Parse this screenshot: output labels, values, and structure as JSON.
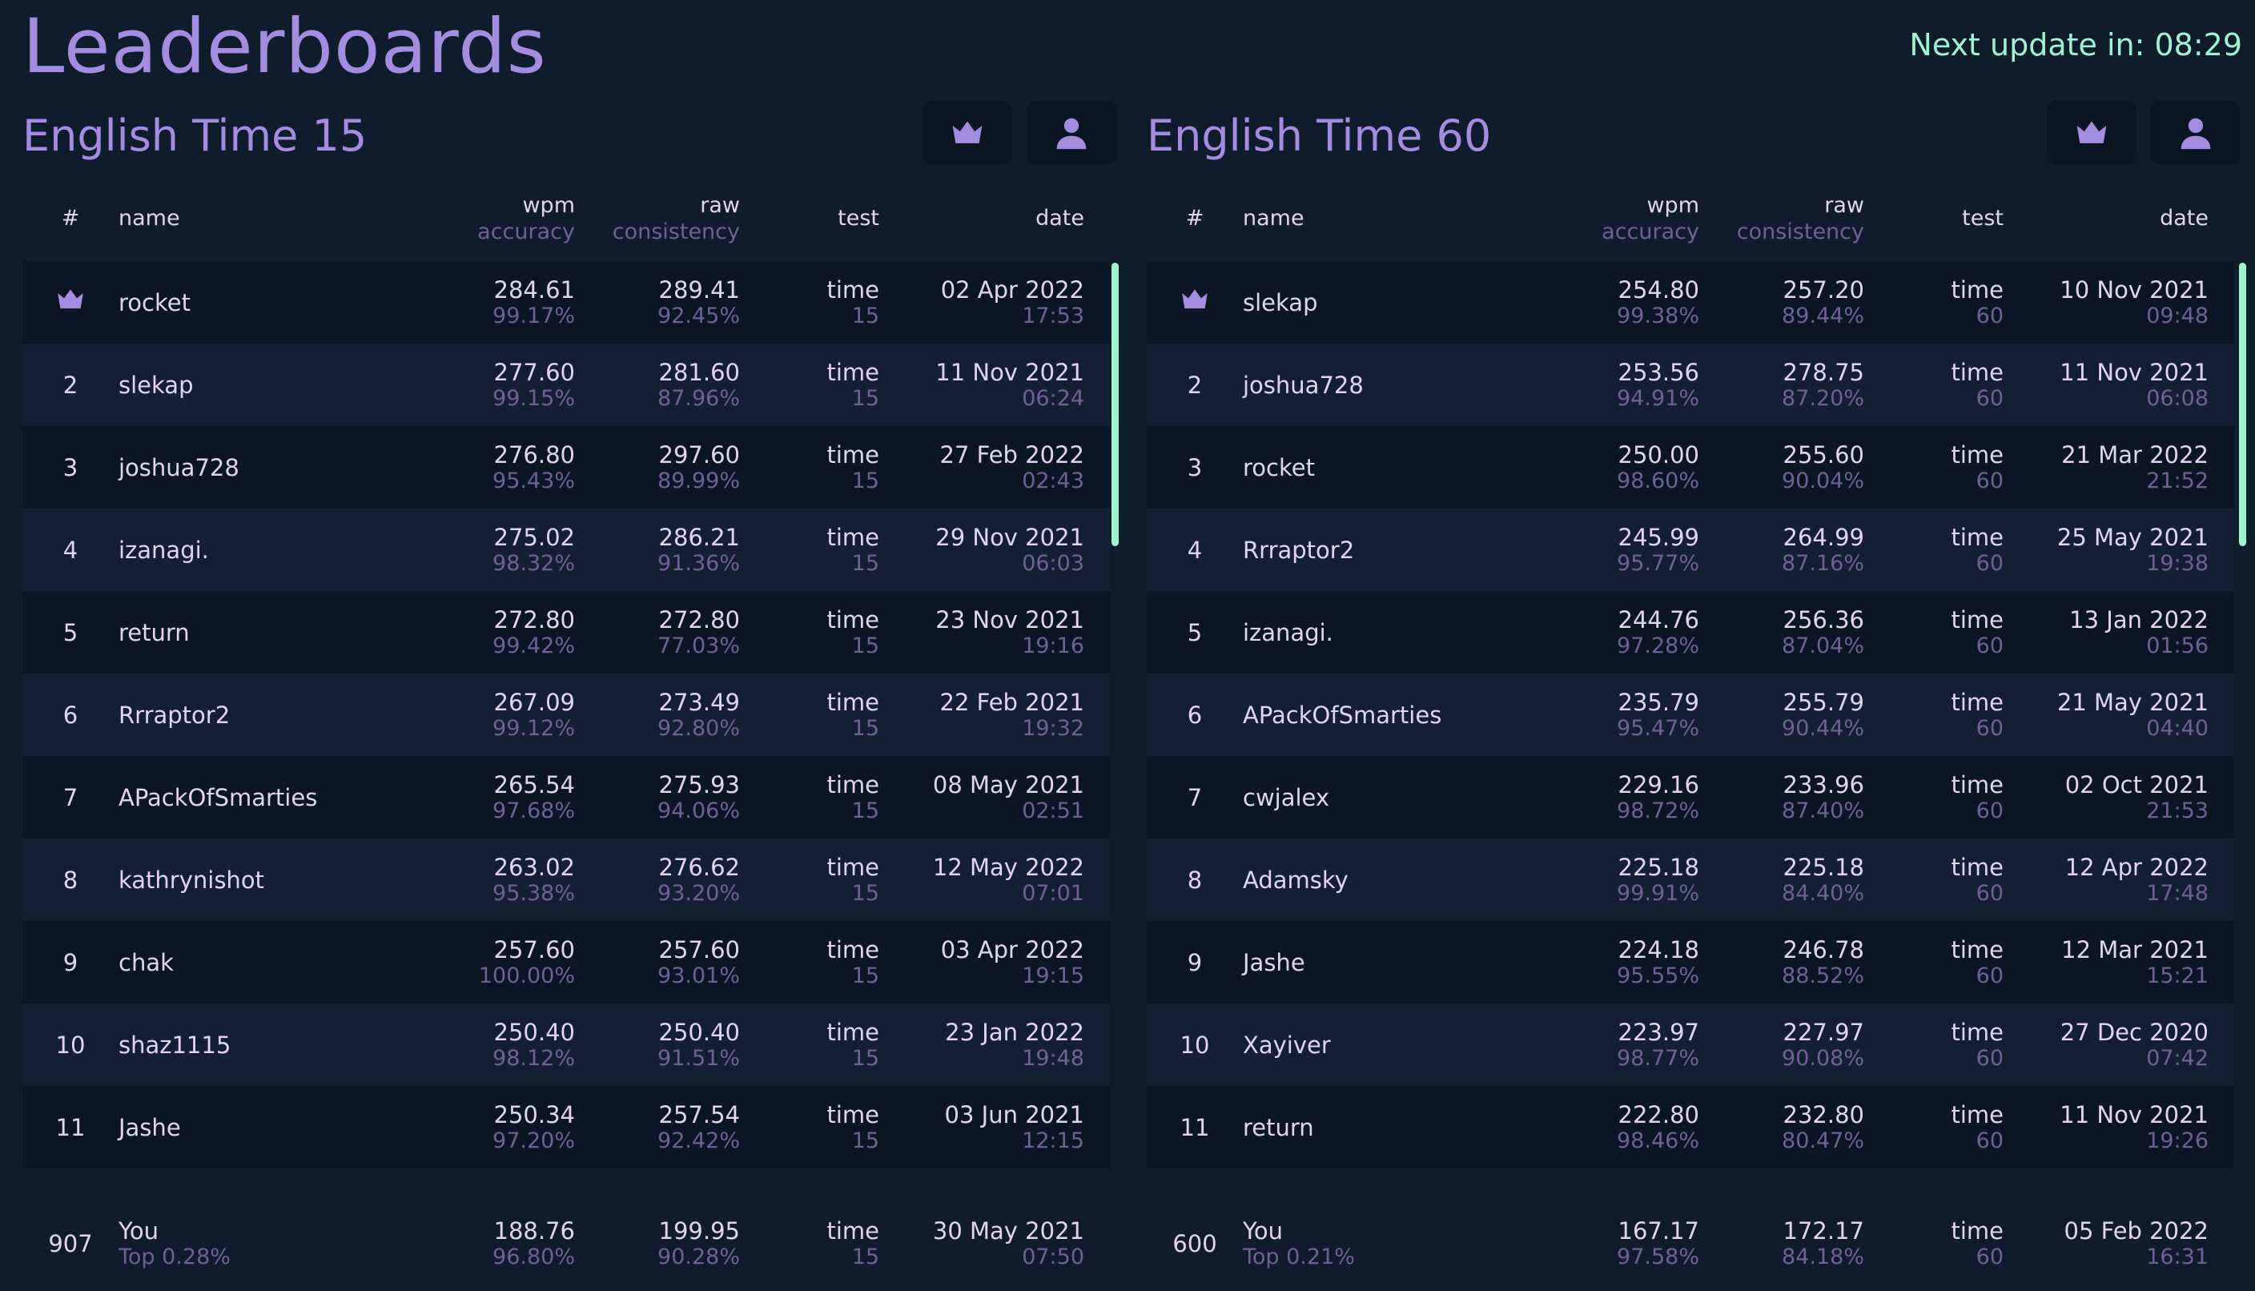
{
  "title": "Leaderboards",
  "timer": "Next update in: 08:29",
  "header": {
    "rank": "#",
    "name": "name",
    "wpm": "wpm",
    "accuracy": "accuracy",
    "raw": "raw",
    "consistency": "consistency",
    "test": "test",
    "date": "date"
  },
  "boards": [
    {
      "title": "English Time 15",
      "rows": [
        {
          "rank": "",
          "name": "rocket",
          "wpm": "284.61",
          "acc": "99.17%",
          "raw": "289.41",
          "con": "92.45%",
          "test": "time",
          "dur": "15",
          "date": "02 Apr 2022",
          "time": "17:53"
        },
        {
          "rank": "2",
          "name": "slekap",
          "wpm": "277.60",
          "acc": "99.15%",
          "raw": "281.60",
          "con": "87.96%",
          "test": "time",
          "dur": "15",
          "date": "11 Nov 2021",
          "time": "06:24"
        },
        {
          "rank": "3",
          "name": "joshua728",
          "wpm": "276.80",
          "acc": "95.43%",
          "raw": "297.60",
          "con": "89.99%",
          "test": "time",
          "dur": "15",
          "date": "27 Feb 2022",
          "time": "02:43"
        },
        {
          "rank": "4",
          "name": "izanagi.",
          "wpm": "275.02",
          "acc": "98.32%",
          "raw": "286.21",
          "con": "91.36%",
          "test": "time",
          "dur": "15",
          "date": "29 Nov 2021",
          "time": "06:03"
        },
        {
          "rank": "5",
          "name": "return",
          "wpm": "272.80",
          "acc": "99.42%",
          "raw": "272.80",
          "con": "77.03%",
          "test": "time",
          "dur": "15",
          "date": "23 Nov 2021",
          "time": "19:16"
        },
        {
          "rank": "6",
          "name": "Rrraptor2",
          "wpm": "267.09",
          "acc": "99.12%",
          "raw": "273.49",
          "con": "92.80%",
          "test": "time",
          "dur": "15",
          "date": "22 Feb 2021",
          "time": "19:32"
        },
        {
          "rank": "7",
          "name": "APackOfSmarties",
          "wpm": "265.54",
          "acc": "97.68%",
          "raw": "275.93",
          "con": "94.06%",
          "test": "time",
          "dur": "15",
          "date": "08 May 2021",
          "time": "02:51"
        },
        {
          "rank": "8",
          "name": "kathrynishot",
          "wpm": "263.02",
          "acc": "95.38%",
          "raw": "276.62",
          "con": "93.20%",
          "test": "time",
          "dur": "15",
          "date": "12 May 2022",
          "time": "07:01"
        },
        {
          "rank": "9",
          "name": "chak",
          "wpm": "257.60",
          "acc": "100.00%",
          "raw": "257.60",
          "con": "93.01%",
          "test": "time",
          "dur": "15",
          "date": "03 Apr 2022",
          "time": "19:15"
        },
        {
          "rank": "10",
          "name": "shaz1115",
          "wpm": "250.40",
          "acc": "98.12%",
          "raw": "250.40",
          "con": "91.51%",
          "test": "time",
          "dur": "15",
          "date": "23 Jan 2022",
          "time": "19:48"
        },
        {
          "rank": "11",
          "name": "Jashe",
          "wpm": "250.34",
          "acc": "97.20%",
          "raw": "257.54",
          "con": "92.42%",
          "test": "time",
          "dur": "15",
          "date": "03 Jun 2021",
          "time": "12:15"
        }
      ],
      "user": {
        "rank": "907",
        "name": "You",
        "top": "Top 0.28%",
        "wpm": "188.76",
        "acc": "96.80%",
        "raw": "199.95",
        "con": "90.28%",
        "test": "time",
        "dur": "15",
        "date": "30 May 2021",
        "time": "07:50"
      }
    },
    {
      "title": "English Time 60",
      "rows": [
        {
          "rank": "",
          "name": "slekap",
          "wpm": "254.80",
          "acc": "99.38%",
          "raw": "257.20",
          "con": "89.44%",
          "test": "time",
          "dur": "60",
          "date": "10 Nov 2021",
          "time": "09:48"
        },
        {
          "rank": "2",
          "name": "joshua728",
          "wpm": "253.56",
          "acc": "94.91%",
          "raw": "278.75",
          "con": "87.20%",
          "test": "time",
          "dur": "60",
          "date": "11 Nov 2021",
          "time": "06:08"
        },
        {
          "rank": "3",
          "name": "rocket",
          "wpm": "250.00",
          "acc": "98.60%",
          "raw": "255.60",
          "con": "90.04%",
          "test": "time",
          "dur": "60",
          "date": "21 Mar 2022",
          "time": "21:52"
        },
        {
          "rank": "4",
          "name": "Rrraptor2",
          "wpm": "245.99",
          "acc": "95.77%",
          "raw": "264.99",
          "con": "87.16%",
          "test": "time",
          "dur": "60",
          "date": "25 May 2021",
          "time": "19:38"
        },
        {
          "rank": "5",
          "name": "izanagi.",
          "wpm": "244.76",
          "acc": "97.28%",
          "raw": "256.36",
          "con": "87.04%",
          "test": "time",
          "dur": "60",
          "date": "13 Jan 2022",
          "time": "01:56"
        },
        {
          "rank": "6",
          "name": "APackOfSmarties",
          "wpm": "235.79",
          "acc": "95.47%",
          "raw": "255.79",
          "con": "90.44%",
          "test": "time",
          "dur": "60",
          "date": "21 May 2021",
          "time": "04:40"
        },
        {
          "rank": "7",
          "name": "cwjalex",
          "wpm": "229.16",
          "acc": "98.72%",
          "raw": "233.96",
          "con": "87.40%",
          "test": "time",
          "dur": "60",
          "date": "02 Oct 2021",
          "time": "21:53"
        },
        {
          "rank": "8",
          "name": "Adamsky",
          "wpm": "225.18",
          "acc": "99.91%",
          "raw": "225.18",
          "con": "84.40%",
          "test": "time",
          "dur": "60",
          "date": "12 Apr 2022",
          "time": "17:48"
        },
        {
          "rank": "9",
          "name": "Jashe",
          "wpm": "224.18",
          "acc": "95.55%",
          "raw": "246.78",
          "con": "88.52%",
          "test": "time",
          "dur": "60",
          "date": "12 Mar 2021",
          "time": "15:21"
        },
        {
          "rank": "10",
          "name": "Xayiver",
          "wpm": "223.97",
          "acc": "98.77%",
          "raw": "227.97",
          "con": "90.08%",
          "test": "time",
          "dur": "60",
          "date": "27 Dec 2020",
          "time": "07:42"
        },
        {
          "rank": "11",
          "name": "return",
          "wpm": "222.80",
          "acc": "98.46%",
          "raw": "232.80",
          "con": "80.47%",
          "test": "time",
          "dur": "60",
          "date": "11 Nov 2021",
          "time": "19:26"
        }
      ],
      "user": {
        "rank": "600",
        "name": "You",
        "top": "Top 0.21%",
        "wpm": "167.17",
        "acc": "97.58%",
        "raw": "172.17",
        "con": "84.18%",
        "test": "time",
        "dur": "60",
        "date": "05 Feb 2022",
        "time": "16:31"
      }
    }
  ]
}
